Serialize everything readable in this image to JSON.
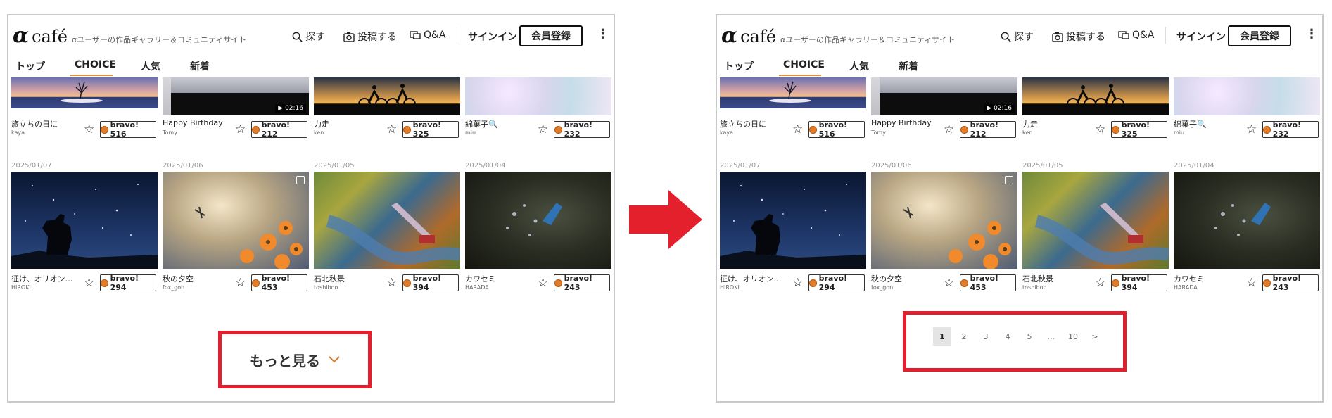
{
  "site": {
    "logo_alpha": "α",
    "logo_cafe": "café",
    "tagline": "αユーザーの作品ギャラリー＆コミュニティサイト"
  },
  "header": {
    "search_label": "探す",
    "post_label": "投稿する",
    "qa_label": "Q&A",
    "signin_label": "サインイン",
    "register_label": "会員登録",
    "more_icon": "⋮"
  },
  "tabs": [
    {
      "label": "トップ"
    },
    {
      "label": "CHOICE",
      "active": true
    },
    {
      "label": "人気"
    },
    {
      "label": "新着"
    }
  ],
  "top_row": [
    {
      "title": "旅立ちの日に",
      "author": "kaya",
      "bravo": "bravo! 516"
    },
    {
      "title": "Happy Birthday",
      "author": "Tomy",
      "bravo": "bravo! 212",
      "duration": "▶ 02:16"
    },
    {
      "title": "力走",
      "author": "ken",
      "bravo": "bravo! 325"
    },
    {
      "title": "綿菓子🔍",
      "author": "miu",
      "bravo": "bravo! 232"
    }
  ],
  "bottom_row": [
    {
      "date": "2025/01/07",
      "title": "征け、オリオン…",
      "author": "HIROKI",
      "bravo": "bravo! 294"
    },
    {
      "date": "2025/01/06",
      "title": "秋の夕空",
      "author": "fox_gon",
      "bravo": "bravo! 453"
    },
    {
      "date": "2025/01/05",
      "title": "石北秋景",
      "author": "toshiboo",
      "bravo": "bravo! 394"
    },
    {
      "date": "2025/01/04",
      "title": "カワセミ",
      "author": "HARADA",
      "bravo": "bravo! 243"
    }
  ],
  "load_more": {
    "label": "もっと見る"
  },
  "pagination": {
    "pages": [
      "1",
      "2",
      "3",
      "4",
      "5",
      "...",
      "10",
      ">"
    ],
    "current": "1"
  },
  "colors": {
    "highlight": "#e0202e",
    "arrow": "#e3202c",
    "tab_accent": "#e08a3c",
    "bravo_icon": "#e07b2a"
  }
}
